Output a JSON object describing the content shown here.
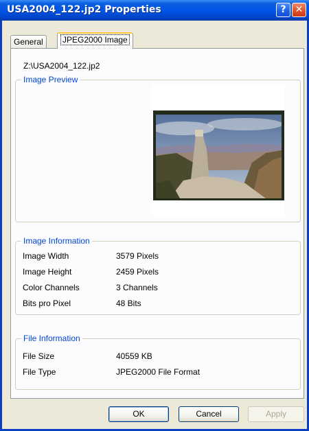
{
  "window": {
    "title": "USA2004_122.jp2 Properties",
    "help_glyph": "?",
    "close_glyph": "✕"
  },
  "tabs": [
    {
      "label": "General",
      "active": false
    },
    {
      "label": "JPEG2000 Image",
      "active": true
    }
  ],
  "file_path": "Z:\\USA2004_122.jp2",
  "image_preview": {
    "title": "Image Preview"
  },
  "image_information": {
    "title": "Image Information",
    "rows": [
      {
        "label": "Image Width",
        "value": "3579 Pixels"
      },
      {
        "label": "Image Height",
        "value": "2459 Pixels"
      },
      {
        "label": "Color Channels",
        "value": "3 Channels"
      },
      {
        "label": "Bits pro Pixel",
        "value": "48 Bits"
      }
    ]
  },
  "file_information": {
    "title": "File Information",
    "rows": [
      {
        "label": "File Size",
        "value": "40559 KB"
      },
      {
        "label": "File Type",
        "value": "JPEG2000 File Format"
      }
    ]
  },
  "buttons": {
    "ok": "OK",
    "cancel": "Cancel",
    "apply": "Apply"
  },
  "colors": {
    "titlebar": "#0055e5",
    "group_title": "#0046d5",
    "tab_highlight": "#ffc83c",
    "dialog_bg": "#ece9d8"
  }
}
